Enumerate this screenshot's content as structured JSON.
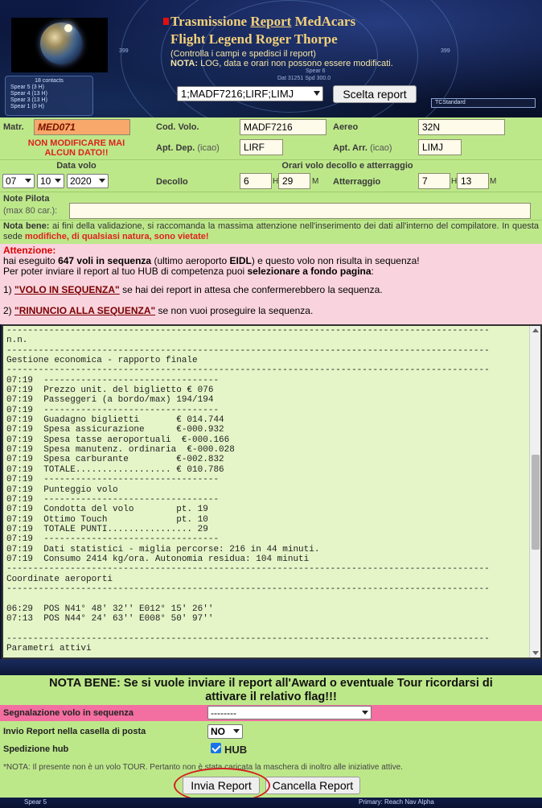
{
  "header": {
    "title_prefix": "Trasmissione ",
    "title_underlined": "Report",
    "title_suffix": " MedAcars",
    "title2": "Flight Legend Roger Thorpe",
    "subtitle1": "(Controlla i campi e spedisci il report)",
    "subtitle2_bold": "NOTA:",
    "subtitle2_rest": " LOG, data e orari non possono essere modificati.",
    "flight_select_value": "1;MADF7216;LIRF;LIMJ",
    "scelta_button": "Scelta report",
    "hud_title": "18 contacts",
    "hud_lines": [
      "Spear 5 (3 H)",
      "Spear 4 (13 H)",
      "Spear 3 (13 H)",
      "Spear 1 (0 H)"
    ],
    "hud_right": "TCStandard",
    "hud_speed_line": "Spear 6",
    "hud_dat": "Dat 31251  Spd 300.0",
    "hud_num_left": "399",
    "hud_num_right": "399"
  },
  "form": {
    "matr_label": "Matr.",
    "matr_value": "MED071",
    "warning_line1": "NON MODIFICARE MAI",
    "warning_line2": "ALCUN DATO!!",
    "cod_volo_label": "Cod. Volo.",
    "cod_volo_value": "MADF7216",
    "aereo_label": "Aereo",
    "aereo_value": "32N",
    "apt_dep_label": "Apt. Dep.",
    "apt_dep_icao": "(icao)",
    "apt_dep_value": "LIRF",
    "apt_arr_label": "Apt. Arr.",
    "apt_arr_icao": "(icao)",
    "apt_arr_value": "LIMJ",
    "data_volo_label": "Data volo",
    "orari_label": "Orari volo decollo e atterraggio",
    "day": "07",
    "month": "10",
    "year": "2020",
    "decollo_label": "Decollo",
    "dec_h": "6",
    "h_label": "H",
    "dec_m": "29",
    "m_label": "M",
    "atterraggio_label": "Atterraggio",
    "att_h": "7",
    "att_m": "13",
    "note_label": "Note Pilota",
    "note_hint": "(max 80 car.):",
    "note_value": "",
    "nota_bene_bold": "Nota bene:",
    "nota_bene_text": " ai fini della validazione, si raccomanda la massima attenzione nell'inserimento dei dati all'interno del compilatore. In questa sede ",
    "nota_bene_red": "modifiche, di qualsiasi natura, sono vietate!"
  },
  "attention": {
    "title": "Attenzione:",
    "l1_a": "hai eseguito ",
    "l1_b": "647 voli in sequenza",
    "l1_c": " (ultimo aeroporto ",
    "l1_d": "EIDL",
    "l1_e": ") e questo volo non risulta in sequenza!",
    "l2_a": "Per poter inviare il report al tuo HUB di competenza puoi ",
    "l2_b": "selezionare a fondo pagina",
    "l2_c": ":",
    "opt1_num": "1) ",
    "opt1_link": "\"VOLO IN SEQUENZA\"",
    "opt1_text": " se hai dei report in attesa che confermerebbero la sequenza.",
    "opt2_num": "2) ",
    "opt2_link": "\"RINUNCIO ALLA SEQUENZA\"",
    "opt2_text": " se non vuoi proseguire la sequenza."
  },
  "log_lines": [
    "-------------------------------------------------------------------------------------------",
    "n.n.",
    "-------------------------------------------------------------------------------------------",
    "Gestione economica - rapporto finale",
    "-------------------------------------------------------------------------------------------",
    "07:19  ---------------------------------",
    "07:19  Prezzo unit. del biglietto € 076",
    "07:19  Passeggeri (a bordo/max) 194/194",
    "07:19  ---------------------------------",
    "07:19  Guadagno biglietti       € 014.744",
    "07:19  Spesa assicurazione      €-000.932",
    "07:19  Spesa tasse aeroportuali  €-000.166",
    "07:19  Spesa manutenz. ordinaria  €-000.028",
    "07:19  Spesa carburante         €-002.832",
    "07:19  TOTALE.................. € 010.786",
    "07:19  ---------------------------------",
    "07:19  Punteggio volo",
    "07:19  ---------------------------------",
    "07:19  Condotta del volo        pt. 19",
    "07:19  Ottimo Touch             pt. 10",
    "07:19  TOTALE PUNTI................ 29",
    "07:19  ---------------------------------",
    "07:19  Dati statistici - miglia percorse: 216 in 44 minuti.",
    "07:19  Consumo 2414 kg/ora. Autonomia residua: 104 minuti",
    "-------------------------------------------------------------------------------------------",
    "Coordinate aeroporti",
    "-------------------------------------------------------------------------------------------",
    "",
    "06:29  POS N41° 48′ 32′′ E012° 15′ 26′′",
    "07:13  POS N44° 24′ 63′′ E008° 50′ 97′′",
    "",
    "-------------------------------------------------------------------------------------------",
    "Parametri attivi"
  ],
  "bottom": {
    "nota_bene_line1": "NOTA BENE: Se si vuole inviare il report all'Award o eventuale Tour ricordarsi di",
    "nota_bene_line2": "attivare il relativo flag!!!",
    "seq_label": "Segnalazione volo in sequenza",
    "seq_value": "--------",
    "invio_label": "Invio Report nella casella di posta",
    "invio_value": "NO",
    "spedizione_label": "Spedizione hub",
    "hub_label": "HUB",
    "nota_footer": "*NOTA: Il presente non è un volo TOUR. Pertanto non è stata caricata la maschera di inoltro alle iniziative attive.",
    "invia_button": "Invia Report",
    "cancella_button": "Cancella Report",
    "strip_left": "Spear 5",
    "strip_right": "Primary: Reach Nav Alpha"
  },
  "colors": {
    "form_bg": "#bde88a",
    "attention_bg": "#f9d4de",
    "seq_row_bg": "#f36ea1",
    "title_gold": "#f2d07a",
    "matr_bg": "#f7a86a"
  }
}
